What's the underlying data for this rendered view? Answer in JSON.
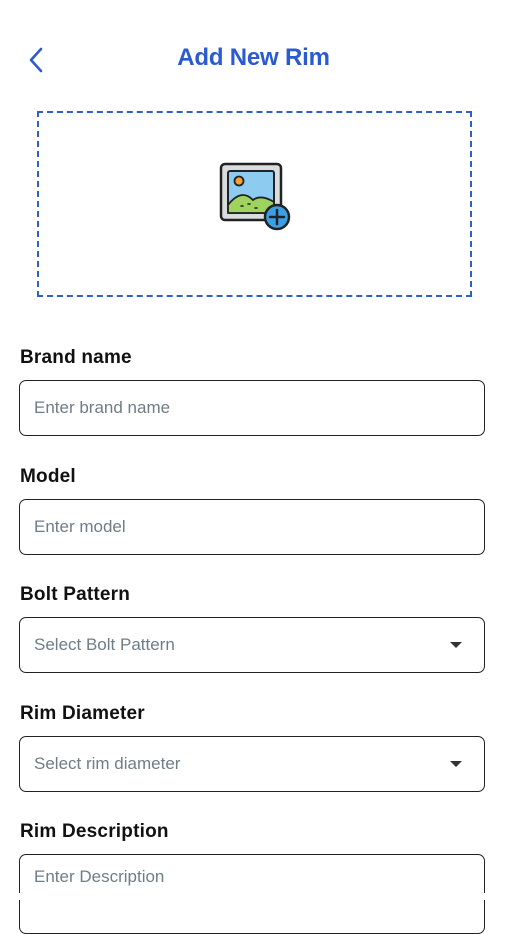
{
  "header": {
    "title": "Add New Rim",
    "back_icon": "chevron-left-icon",
    "accent_color": "#2b5bd0"
  },
  "upload": {
    "icon": "add-image-icon"
  },
  "form": {
    "brand": {
      "label": "Brand name",
      "placeholder": "Enter brand name",
      "value": ""
    },
    "model": {
      "label": "Model",
      "placeholder": "Enter model",
      "value": ""
    },
    "bolt_pattern": {
      "label": "Bolt Pattern",
      "selected": "Select Bolt Pattern",
      "icon": "caret-down-icon"
    },
    "rim_diameter": {
      "label": "Rim Diameter",
      "selected": "Select rim diameter",
      "icon": "caret-down-icon"
    },
    "description": {
      "label": "Rim Description",
      "placeholder": "Enter Description",
      "value": ""
    }
  }
}
